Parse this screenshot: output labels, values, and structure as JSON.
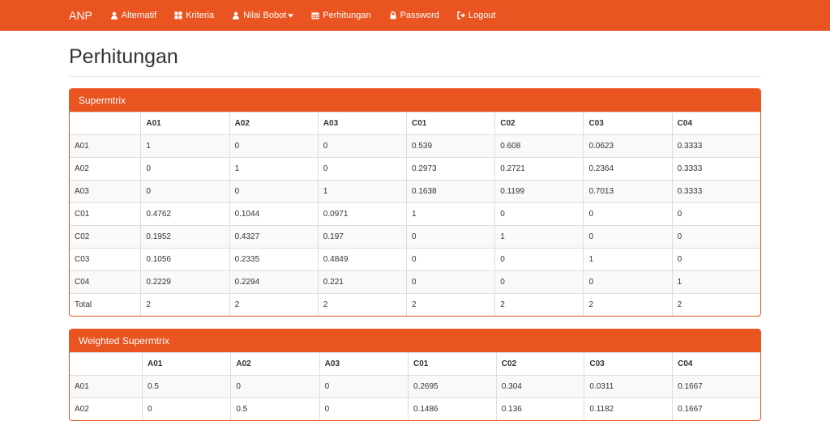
{
  "nav": {
    "brand": "ANP",
    "items": [
      {
        "label": "Alternatif",
        "icon": "user-icon"
      },
      {
        "label": "Kriteria",
        "icon": "grid-icon"
      },
      {
        "label": "Nilai Bobot",
        "icon": "user-icon",
        "dropdown": true
      },
      {
        "label": "Perhitungan",
        "icon": "calendar-icon"
      },
      {
        "label": "Password",
        "icon": "lock-icon"
      },
      {
        "label": "Logout",
        "icon": "logout-icon"
      }
    ]
  },
  "page": {
    "title": "Perhitungan"
  },
  "supermatrix": {
    "title": "Supermtrix",
    "headers": [
      "",
      "A01",
      "A02",
      "A03",
      "C01",
      "C02",
      "C03",
      "C04"
    ],
    "rows": [
      [
        "A01",
        "1",
        "0",
        "0",
        "0.539",
        "0.608",
        "0.0623",
        "0.3333"
      ],
      [
        "A02",
        "0",
        "1",
        "0",
        "0.2973",
        "0.2721",
        "0.2364",
        "0.3333"
      ],
      [
        "A03",
        "0",
        "0",
        "1",
        "0.1638",
        "0.1199",
        "0.7013",
        "0.3333"
      ],
      [
        "C01",
        "0.4762",
        "0.1044",
        "0.0971",
        "1",
        "0",
        "0",
        "0"
      ],
      [
        "C02",
        "0.1952",
        "0.4327",
        "0.197",
        "0",
        "1",
        "0",
        "0"
      ],
      [
        "C03",
        "0.1056",
        "0.2335",
        "0.4849",
        "0",
        "0",
        "1",
        "0"
      ],
      [
        "C04",
        "0.2229",
        "0.2294",
        "0.221",
        "0",
        "0",
        "0",
        "1"
      ],
      [
        "Total",
        "2",
        "2",
        "2",
        "2",
        "2",
        "2",
        "2"
      ]
    ]
  },
  "weighted": {
    "title": "Weighted Supermtrix",
    "headers": [
      "",
      "A01",
      "A02",
      "A03",
      "C01",
      "C02",
      "C03",
      "C04"
    ],
    "rows": [
      [
        "A01",
        "0.5",
        "0",
        "0",
        "0.2695",
        "0.304",
        "0.0311",
        "0.1667"
      ],
      [
        "A02",
        "0",
        "0.5",
        "0",
        "0.1486",
        "0.136",
        "0.1182",
        "0.1667"
      ]
    ]
  }
}
